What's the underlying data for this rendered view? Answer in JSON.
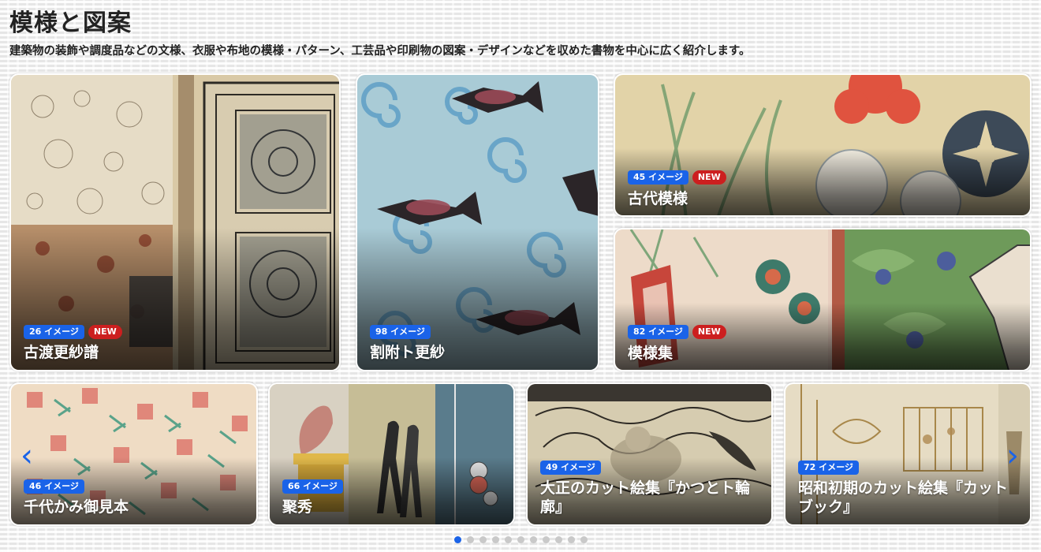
{
  "header": {
    "title": "模様と図案",
    "description": "建築物の装飾や調度品などの文様、衣服や布地の模様・パターン、工芸品や印刷物の図案・デザインなどを収めた書物を中心に広く紹介します。"
  },
  "featured": [
    {
      "title": "古渡更紗譜",
      "count": "26 イメージ",
      "new": "NEW"
    },
    {
      "title": "割附ト更紗",
      "count": "98 イメージ"
    },
    {
      "title": "古代模様",
      "count": "45 イメージ",
      "new": "NEW"
    },
    {
      "title": "模様集",
      "count": "82 イメージ",
      "new": "NEW"
    }
  ],
  "carousel": {
    "items": [
      {
        "title": "千代かみ御見本",
        "count": "46 イメージ"
      },
      {
        "title": "聚秀",
        "count": "66 イメージ"
      },
      {
        "title": "大正のカット絵集『かつとト輪廓』",
        "count": "49 イメージ"
      },
      {
        "title": "昭和初期のカット絵集『カットブック』",
        "count": "72 イメージ"
      }
    ],
    "prev_icon": "‹",
    "next_icon": "›",
    "active_page": 1,
    "page_count": 11
  },
  "colors": {
    "accent": "#1a63e8",
    "new_badge": "#cc1f1f"
  }
}
